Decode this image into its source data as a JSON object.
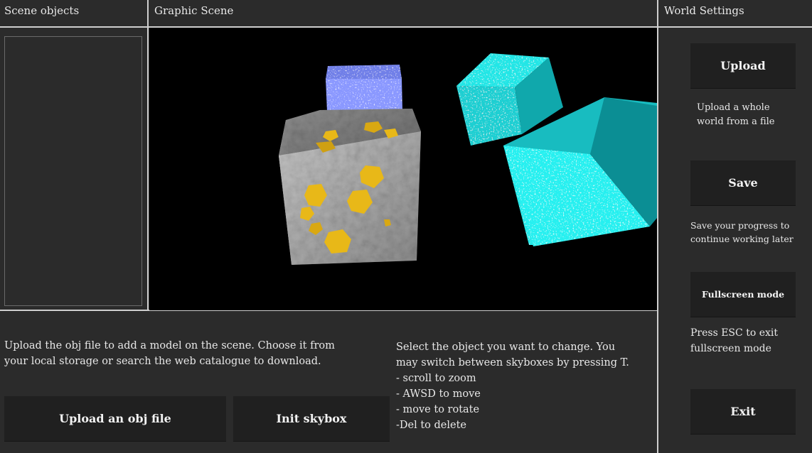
{
  "panels": {
    "scene_objects": "Scene objects",
    "graphic_scene": "Graphic Scene",
    "world_settings": "World Settings"
  },
  "left_help": "Upload the obj file to add a model on the scene. Choose it from\nyour local storage or search the web catalogue to download.",
  "controls_help": "Select the object you want to change. You\nmay switch between skyboxes by pressing T.\n- scroll to zoom\n- AWSD to move\n- move to rotate\n-Del to delete",
  "buttons": {
    "upload_obj": "Upload an obj file",
    "init_skybox": "Init skybox",
    "upload": "Upload",
    "save": "Save",
    "fullscreen": "Fullscreen mode",
    "exit": "Exit"
  },
  "world_settings": {
    "upload_desc": "Upload a whole\nworld from a file",
    "save_desc": "Save your progress to\ncontinue working later",
    "fullscreen_desc": "Press ESC to exit\nfullscreen mode"
  },
  "scene": {
    "objects": [
      "blue-ice-cube",
      "gold-ore-cube",
      "cyan-cube-small",
      "cyan-cube-large"
    ],
    "colors": {
      "background": "#000000",
      "gold_ore": "#a8a8a8",
      "gold_spot": "#e8b818",
      "ice": "#7f8ff0",
      "cyan": "#22e6e6"
    }
  }
}
